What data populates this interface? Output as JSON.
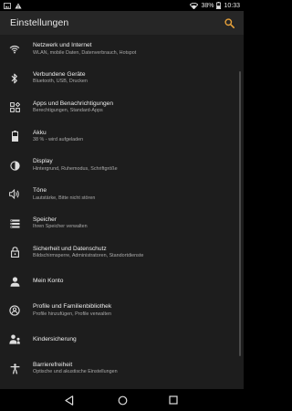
{
  "status_bar": {
    "battery_percent": "38%",
    "time": "10:33"
  },
  "app_bar": {
    "title": "Einstellungen"
  },
  "items": [
    {
      "title": "Netzwerk und Internet",
      "subtitle": "WLAN, mobile Daten, Datenverbrauch, Hotspot",
      "icon": "wifi-icon"
    },
    {
      "title": "Verbundene Geräte",
      "subtitle": "Bluetooth, USB, Drucken",
      "icon": "bluetooth-icon"
    },
    {
      "title": "Apps und Benachrichtigungen",
      "subtitle": "Berechtigungen, Standard-Apps",
      "icon": "apps-icon"
    },
    {
      "title": "Akku",
      "subtitle": "38 % - wird aufgeladen",
      "icon": "battery-icon"
    },
    {
      "title": "Display",
      "subtitle": "Hintergrund, Ruhemodus, Schriftgröße",
      "icon": "display-icon"
    },
    {
      "title": "Töne",
      "subtitle": "Lautstärke, Bitte nicht stören",
      "icon": "volume-icon"
    },
    {
      "title": "Speicher",
      "subtitle": "Ihren Speicher verwalten",
      "icon": "storage-icon"
    },
    {
      "title": "Sicherheit und Datenschutz",
      "subtitle": "Bildschirmsperre, Administratoren, Standortdienste",
      "icon": "lock-icon"
    },
    {
      "title": "Mein Konto",
      "subtitle": "",
      "icon": "person-icon"
    },
    {
      "title": "Profile und Familienbibliothek",
      "subtitle": "Profile hinzufügen, Profile verwalten",
      "icon": "profiles-icon"
    },
    {
      "title": "Kindersicherung",
      "subtitle": "",
      "icon": "parental-icon"
    },
    {
      "title": "Barrierefreiheit",
      "subtitle": "Optische und akustische Einstellungen",
      "icon": "accessibility-icon"
    }
  ],
  "colors": {
    "accent": "#e8a23a",
    "background": "#1d1d1d",
    "app_bar": "#262626"
  }
}
